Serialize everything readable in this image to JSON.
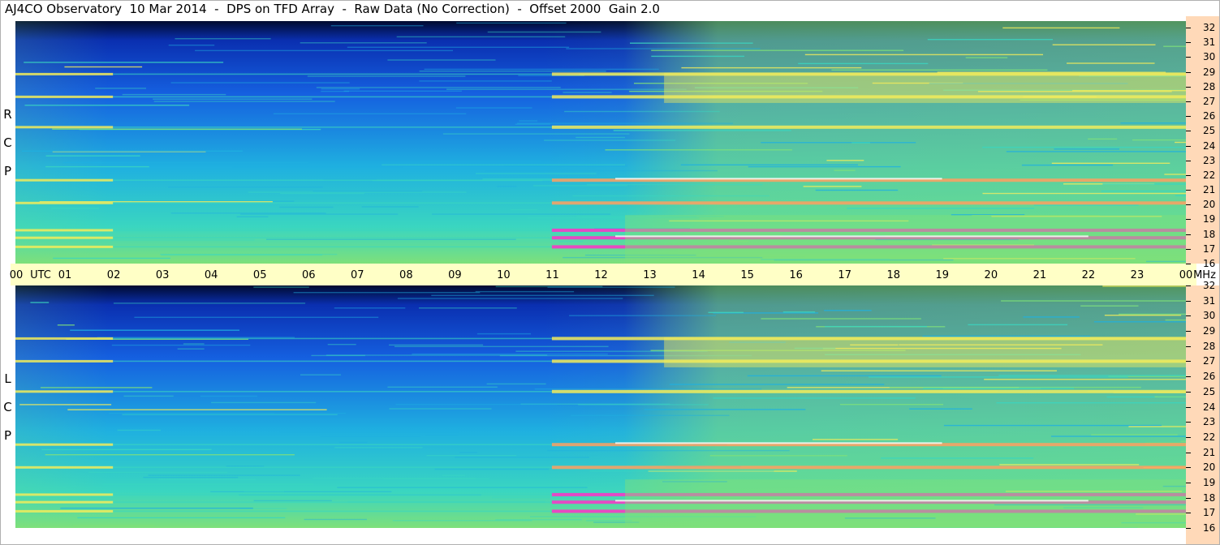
{
  "title": "AJ4CO Observatory  10 Mar 2014  -  DPS on TFD Array  -  Raw Data (No Correction)  -  Offset 2000  Gain 2.0",
  "panels": [
    {
      "label": [
        "R",
        "C",
        "P"
      ]
    },
    {
      "label": [
        "L",
        "C",
        "P"
      ]
    }
  ],
  "time_axis": {
    "labels": [
      "00",
      "01",
      "02",
      "03",
      "04",
      "05",
      "06",
      "07",
      "08",
      "09",
      "10",
      "11",
      "12",
      "13",
      "14",
      "15",
      "16",
      "17",
      "18",
      "19",
      "20",
      "21",
      "22",
      "23",
      "00"
    ],
    "utc_label": "UTC",
    "unit_label": "MHz"
  },
  "freq_axis": {
    "labels": [
      "16",
      "17",
      "18",
      "19",
      "20",
      "21",
      "22",
      "23",
      "24",
      "25",
      "26",
      "27",
      "28",
      "29",
      "30",
      "31",
      "32"
    ]
  },
  "colors": {
    "dark": "#000a2e",
    "deep_blue": "#0a2fb0",
    "blue": "#1560e0",
    "cyan": "#1fb0e0",
    "teal": "#3ad6c0",
    "green": "#7ee07a",
    "yellow": "#f2ec5a",
    "orange": "#ffa060",
    "magenta": "#ff30c8",
    "white": "#ffffff",
    "time_strip": "#ffffc6",
    "freq_strip": "#ffd9b8"
  },
  "chart_data": {
    "type": "heatmap",
    "title": "AJ4CO Observatory  10 Mar 2014  -  DPS on TFD Array  -  Raw Data (No Correction)  -  Offset 2000  Gain 2.0",
    "x_range_utc_hours": [
      0,
      24
    ],
    "y_range_mhz": [
      16,
      32
    ],
    "series": [
      {
        "name": "RCP",
        "interference_bands_mhz": [
          17.1,
          17.7,
          18.2,
          20.0,
          21.5,
          25.0,
          27.0,
          28.5
        ],
        "quiet_interval_utc_hours": [
          2,
          11
        ]
      },
      {
        "name": "LCP",
        "interference_bands_mhz": [
          17.1,
          17.7,
          18.2,
          20.0,
          21.5,
          25.0,
          27.0,
          28.5
        ],
        "quiet_interval_utc_hours": [
          2,
          11
        ]
      }
    ]
  }
}
